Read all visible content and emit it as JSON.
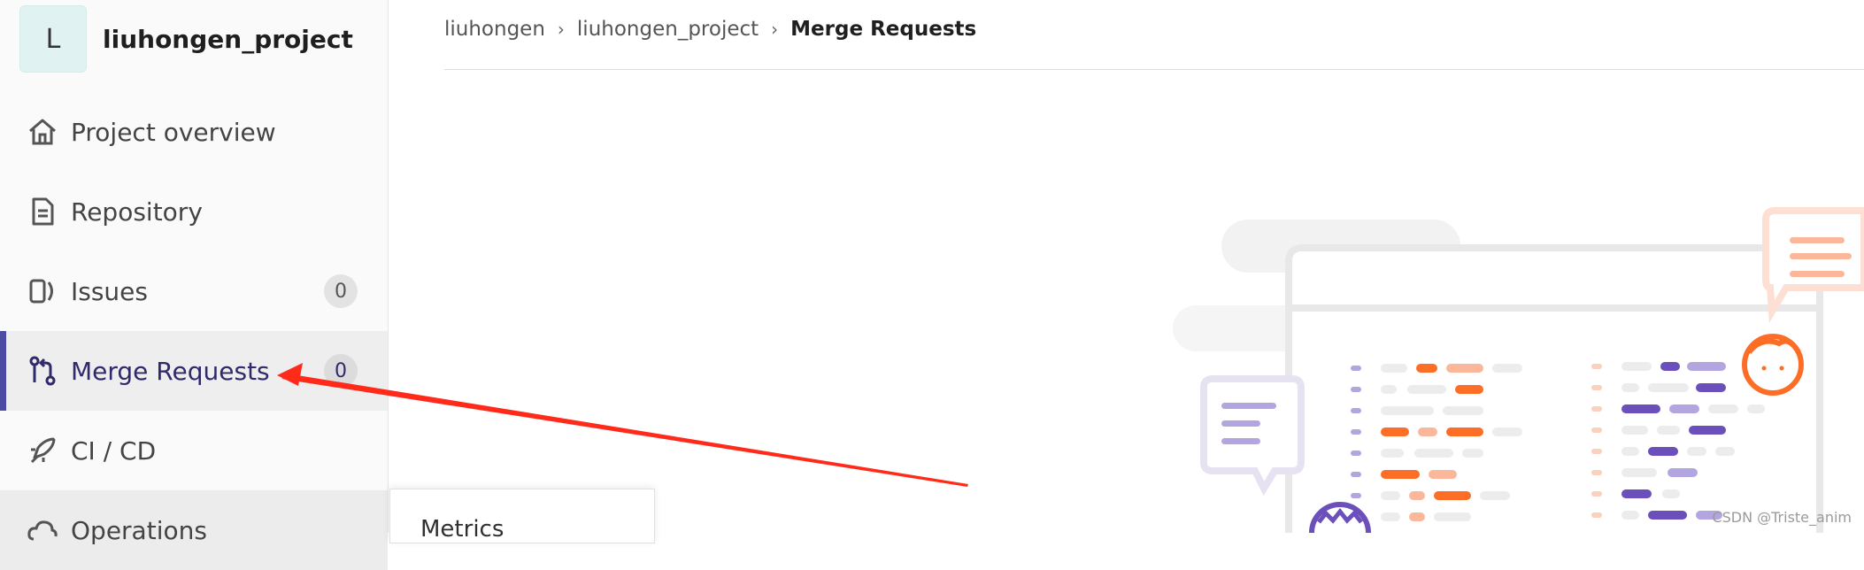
{
  "sidebar": {
    "project": {
      "avatar_letter": "L",
      "name": "liuhongen_project"
    },
    "items": [
      {
        "label": "Project overview",
        "icon": "home-icon"
      },
      {
        "label": "Repository",
        "icon": "document-icon"
      },
      {
        "label": "Issues",
        "icon": "issues-icon",
        "count": "0"
      },
      {
        "label": "Merge Requests",
        "icon": "merge-request-icon",
        "count": "0",
        "active": true
      },
      {
        "label": "CI / CD",
        "icon": "rocket-icon"
      },
      {
        "label": "Operations",
        "icon": "cloud-gear-icon"
      }
    ],
    "flyout": {
      "items": [
        "Metrics"
      ]
    }
  },
  "breadcrumb": [
    "liuhongen",
    "liuhongen_project",
    "Merge Requests"
  ],
  "watermark": "CSDN @Triste_anim",
  "colors": {
    "accent": "#4b4ba3",
    "annotation_arrow": "#ff2a1a",
    "illustration_orange": "#fc6d26",
    "illustration_purple": "#6b4fbb"
  }
}
